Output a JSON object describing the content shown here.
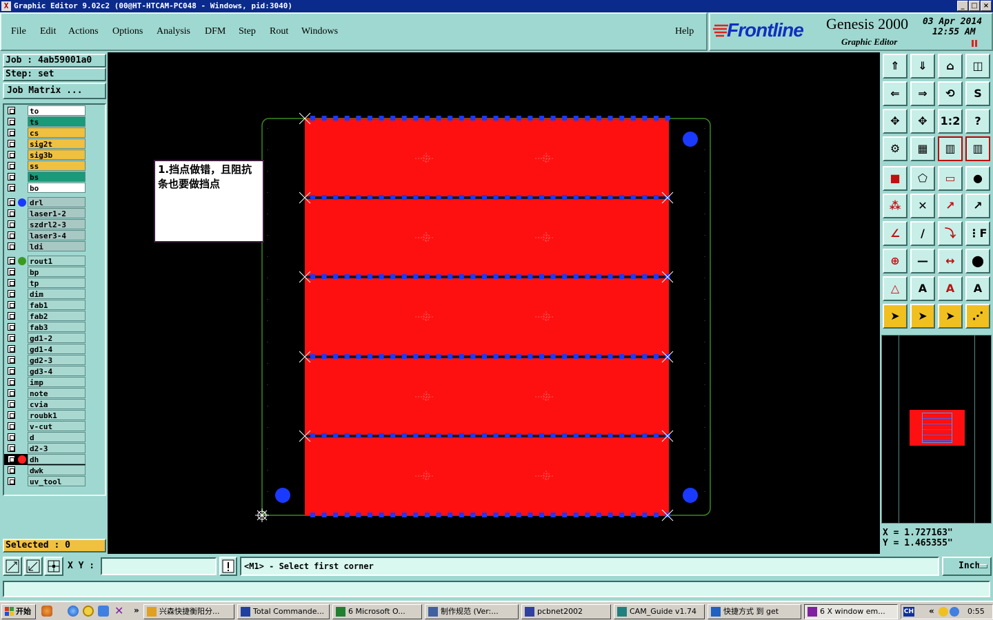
{
  "window": {
    "title": "Graphic Editor 9.02c2 (00@HT-HTCAM-PC048 - Windows, pid:3040)",
    "controls": [
      "_",
      "□",
      "×"
    ]
  },
  "menu": {
    "items": [
      "File",
      "Edit",
      "Actions",
      "Options",
      "Analysis",
      "DFM",
      "Step",
      "Rout",
      "Windows"
    ],
    "help": "Help"
  },
  "brand": {
    "logo": "Frontline",
    "product": "Genesis 2000",
    "subtitle": "Graphic Editor",
    "date": "03 Apr 2014",
    "time": "12:55 AM"
  },
  "job": {
    "job_label": "Job : 4ab59001a0",
    "step_label": "Step: set",
    "matrix_button": "Job Matrix ..."
  },
  "layers": [
    {
      "name": "to",
      "color": "#ffffff",
      "dot": null
    },
    {
      "name": "ts",
      "color": "#1a9a78",
      "dot": null
    },
    {
      "name": "cs",
      "color": "#f0c040",
      "dot": null
    },
    {
      "name": "sig2t",
      "color": "#f0c040",
      "dot": null
    },
    {
      "name": "sig3b",
      "color": "#f0c040",
      "dot": null
    },
    {
      "name": "ss",
      "color": "#f0c040",
      "dot": null
    },
    {
      "name": "bs",
      "color": "#1a9a78",
      "dot": null
    },
    {
      "name": "bo",
      "color": "#ffffff",
      "dot": null
    },
    {
      "name": "drl",
      "color": "#a8c8c4",
      "dot": "#1a3aff"
    },
    {
      "name": "laser1-2",
      "color": "#a8c8c4",
      "dot": null
    },
    {
      "name": "szdrl2-3",
      "color": "#a8c8c4",
      "dot": null
    },
    {
      "name": "laser3-4",
      "color": "#a8c8c4",
      "dot": null
    },
    {
      "name": "ldi",
      "color": "#a8c8c4",
      "dot": null
    },
    {
      "name": "rout1",
      "color": "#a8d8d0",
      "dot": "#3a9a20"
    },
    {
      "name": "bp",
      "color": "#a8d8d0",
      "dot": null
    },
    {
      "name": "tp",
      "color": "#a8d8d0",
      "dot": null
    },
    {
      "name": "dim",
      "color": "#a8d8d0",
      "dot": null
    },
    {
      "name": "fab1",
      "color": "#a8d8d0",
      "dot": null
    },
    {
      "name": "fab2",
      "color": "#a8d8d0",
      "dot": null
    },
    {
      "name": "fab3",
      "color": "#a8d8d0",
      "dot": null
    },
    {
      "name": "gd1-2",
      "color": "#a8d8d0",
      "dot": null
    },
    {
      "name": "gd1-4",
      "color": "#a8d8d0",
      "dot": null
    },
    {
      "name": "gd2-3",
      "color": "#a8d8d0",
      "dot": null
    },
    {
      "name": "gd3-4",
      "color": "#a8d8d0",
      "dot": null
    },
    {
      "name": "imp",
      "color": "#a8d8d0",
      "dot": null
    },
    {
      "name": "note",
      "color": "#a8d8d0",
      "dot": null
    },
    {
      "name": "cvia",
      "color": "#a8d8d0",
      "dot": null
    },
    {
      "name": "roubk1",
      "color": "#a8d8d0",
      "dot": null
    },
    {
      "name": "v-cut",
      "color": "#a8d8d0",
      "dot": null
    },
    {
      "name": "d",
      "color": "#a8d8d0",
      "dot": null
    },
    {
      "name": "d2-3",
      "color": "#a8d8d0",
      "dot": null
    },
    {
      "name": "dh",
      "color": "#a8d8d0",
      "dot": "#ff2020"
    },
    {
      "name": "dwk",
      "color": "#a8d8d0",
      "dot": null
    },
    {
      "name": "uv_tool",
      "color": "#a8d8d0",
      "dot": null
    }
  ],
  "selected_label": "Selected : 0",
  "note": {
    "line1": "1.挡点做错，且阻抗",
    "line2": "条也要做挡点"
  },
  "coords": {
    "x": "X = 1.727163\"",
    "y": "Y = 1.465355\""
  },
  "bottom": {
    "xy_label": "X Y :",
    "xy_value": "",
    "prompt": "<M1> - Select first corner",
    "unit": "Inch"
  },
  "taskbar": {
    "start": "开始",
    "tasks": [
      "兴森快捷衡阳分...",
      "Total Commande...",
      "6 Microsoft O...",
      "制作规范  (Ver:...",
      "pcbnet2002",
      "CAM_Guide v1.74",
      "快捷方式 到 get",
      "6 X window em..."
    ],
    "lang": "CH",
    "clock": "0:55"
  },
  "colors": {
    "panel": "#9fd8d0",
    "board": "#ff1010",
    "pads": "#1a3aff",
    "outline": "#3a8a20"
  }
}
